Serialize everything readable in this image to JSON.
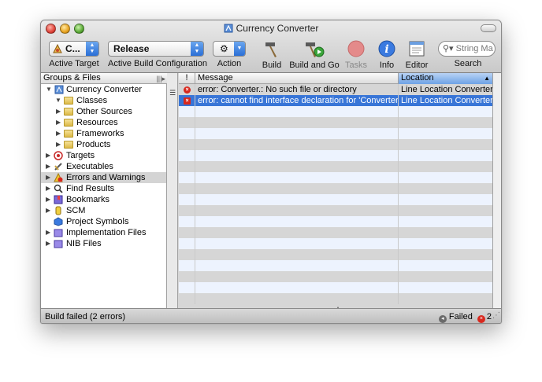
{
  "window": {
    "title": "Currency Converter"
  },
  "toolbar": {
    "active_target": {
      "value": "C...",
      "label": "Active Target"
    },
    "build_config": {
      "value": "Release",
      "label": "Active Build Configuration"
    },
    "action": {
      "label": "Action"
    },
    "build": {
      "label": "Build"
    },
    "build_and_go": {
      "label": "Build and Go"
    },
    "tasks": {
      "label": "Tasks"
    },
    "info": {
      "label": "Info"
    },
    "editor": {
      "label": "Editor"
    },
    "search": {
      "placeholder": "String Ma",
      "label": "Search"
    }
  },
  "sidebar": {
    "header": "Groups & Files",
    "items": [
      {
        "label": "Currency Converter",
        "icon": "project-icon",
        "expanded": true,
        "level": 0
      },
      {
        "label": "Classes",
        "icon": "folder-icon",
        "expanded": true,
        "level": 1
      },
      {
        "label": "Other Sources",
        "icon": "folder-icon",
        "expanded": false,
        "level": 1
      },
      {
        "label": "Resources",
        "icon": "folder-icon",
        "expanded": false,
        "level": 1
      },
      {
        "label": "Frameworks",
        "icon": "folder-icon",
        "expanded": false,
        "level": 1
      },
      {
        "label": "Products",
        "icon": "folder-icon",
        "expanded": false,
        "level": 1
      },
      {
        "label": "Targets",
        "icon": "target-icon",
        "expanded": false,
        "level": 0
      },
      {
        "label": "Executables",
        "icon": "executable-icon",
        "expanded": false,
        "level": 0
      },
      {
        "label": "Errors and Warnings",
        "icon": "warning-icon",
        "expanded": false,
        "level": 0,
        "selected": true
      },
      {
        "label": "Find Results",
        "icon": "magnifier-icon",
        "expanded": false,
        "level": 0
      },
      {
        "label": "Bookmarks",
        "icon": "bookmark-icon",
        "expanded": false,
        "level": 0
      },
      {
        "label": "SCM",
        "icon": "scm-icon",
        "expanded": false,
        "level": 0
      },
      {
        "label": "Project Symbols",
        "icon": "symbols-icon",
        "expanded": null,
        "level": 0
      },
      {
        "label": "Implementation Files",
        "icon": "smart-group-icon",
        "expanded": false,
        "level": 0
      },
      {
        "label": "NIB Files",
        "icon": "smart-group-icon",
        "expanded": false,
        "level": 0
      }
    ]
  },
  "table": {
    "columns": {
      "warning": "!",
      "message": "Message",
      "location": "Location"
    },
    "rows": [
      {
        "message": "error: Converter.: No such file or directory",
        "location": "Line Location Converter."
      },
      {
        "message": "error: cannot find interface declaration for 'Converter'",
        "location": "Line Location Converter.",
        "selected": true
      }
    ]
  },
  "status": {
    "message": "Build failed (2 errors)",
    "result": "Failed",
    "error_count": "2"
  },
  "colors": {
    "selection": "#3875d7",
    "error": "#d8281e",
    "stripe": "#edf3fe"
  }
}
